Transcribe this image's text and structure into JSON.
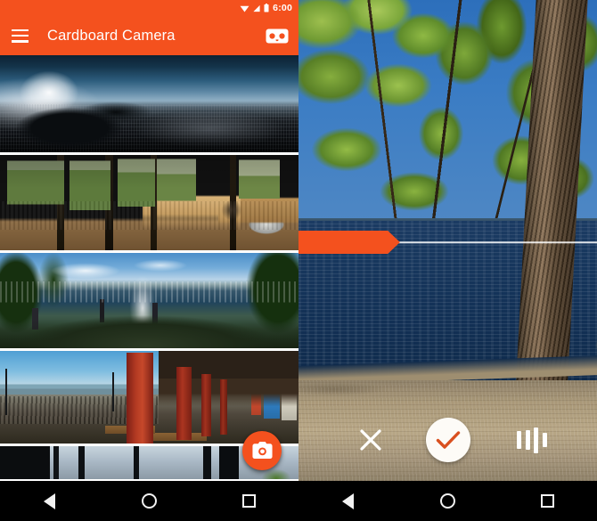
{
  "app": {
    "name": "Cardboard Camera",
    "accent_color": "#F4511E",
    "screens": [
      "gallery",
      "capture-review"
    ]
  },
  "left_screen": {
    "statusbar": {
      "time": "6:00",
      "icons": [
        "wifi-icon",
        "cellular-signal-icon",
        "battery-icon"
      ]
    },
    "appbar": {
      "menu_icon": "hamburger-menu-icon",
      "title": "Cardboard Camera",
      "action_icon": "cardboard-vr-viewer-icon",
      "background_color": "#F4511E",
      "text_color": "#FFFFFF"
    },
    "gallery": {
      "items": [
        {
          "id": 1,
          "description": "Mountain summit panorama above clouds with distant city"
        },
        {
          "id": 2,
          "description": "Converted camper van interior with wood table and sink"
        },
        {
          "id": 3,
          "description": "Geyser hot spring landscape with steam, trees and people"
        },
        {
          "id": 4,
          "description": "Seaside boardwalk arcade with red columns at sunset"
        },
        {
          "id": 5,
          "description": "Bridge truss structures against bright sky"
        }
      ]
    },
    "fab": {
      "icon": "camera-icon",
      "label": "Capture VR photo",
      "color": "#F4511E"
    }
  },
  "right_screen": {
    "photo": {
      "description": "VR panorama of a lakeside with a large tree, blue water and sandy shore"
    },
    "progress": {
      "label": "Capture sweep progress",
      "percent": 34,
      "color": "#F4511E"
    },
    "controls": [
      {
        "name": "cancel",
        "icon": "close-x-icon",
        "label": "Discard"
      },
      {
        "name": "confirm",
        "icon": "check-icon",
        "label": "Save",
        "color": "#D9501F"
      },
      {
        "name": "audio",
        "icon": "audio-waveform-icon",
        "label": "Ambient audio"
      }
    ]
  },
  "navbar": {
    "buttons": [
      {
        "name": "back",
        "icon": "back-triangle-icon"
      },
      {
        "name": "home",
        "icon": "home-circle-icon"
      },
      {
        "name": "recents",
        "icon": "recents-square-icon"
      }
    ]
  }
}
